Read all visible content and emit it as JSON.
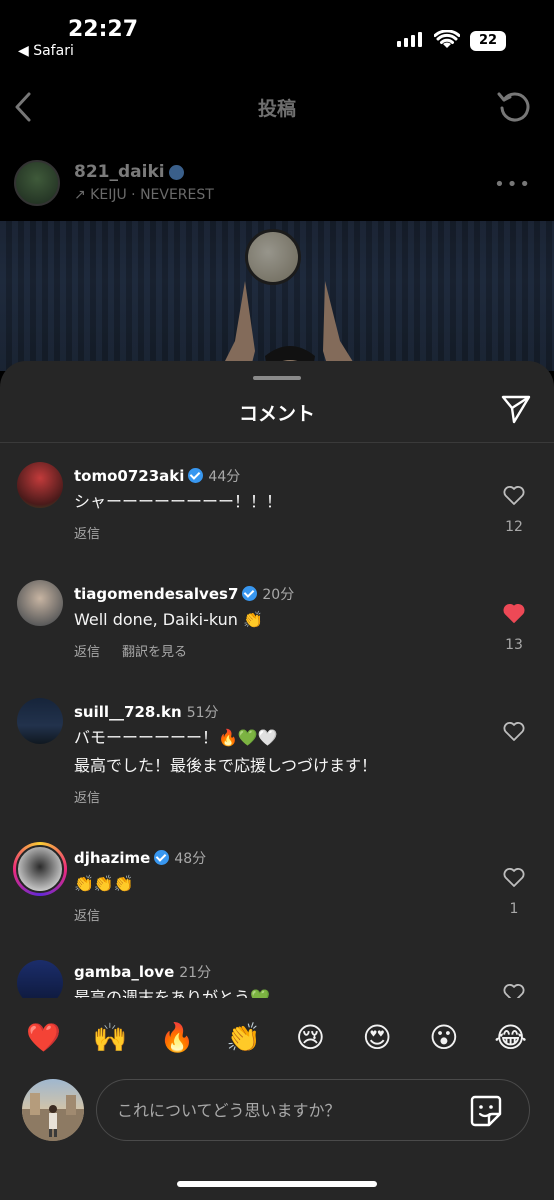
{
  "status_bar": {
    "time": "22:27",
    "back_app": "◀ Safari",
    "battery": "22"
  },
  "header": {
    "title": "投稿"
  },
  "post": {
    "username": "821_daiki",
    "sub": "↗ KEIJU · NEVEREST"
  },
  "sheet": {
    "title": "コメント"
  },
  "comments": [
    {
      "username": "tomo0723aki",
      "verified": true,
      "time": "44分",
      "lines": [
        "シャーーーーーーーー！！！"
      ],
      "actions": [
        "返信"
      ],
      "liked": false,
      "likes": "12"
    },
    {
      "username": "tiagomendesalves7",
      "verified": true,
      "time": "20分",
      "lines": [
        "Well done, Daiki-kun 👏"
      ],
      "actions": [
        "返信",
        "翻訳を見る"
      ],
      "liked": true,
      "likes": "13"
    },
    {
      "username": "suill__728.kn",
      "verified": false,
      "time": "51分",
      "lines": [
        "バモーーーーーー！🔥💚🤍",
        "最高でした！最後まで応援しつづけます！"
      ],
      "actions": [
        "返信"
      ],
      "liked": false,
      "likes": ""
    },
    {
      "username": "djhazime",
      "verified": true,
      "time": "48分",
      "lines": [
        "👏👏👏"
      ],
      "actions": [
        "返信"
      ],
      "liked": false,
      "likes": "1"
    },
    {
      "username": "gamba_love",
      "verified": false,
      "time": "21分",
      "lines": [
        "最高の週末をありがとう💚"
      ],
      "actions": [],
      "liked": false,
      "likes": ""
    }
  ],
  "emoji_bar": [
    "❤️",
    "🙌",
    "🔥",
    "👏",
    "😢",
    "😍",
    "😮",
    "😂"
  ],
  "composer": {
    "placeholder": "これについてどう思いますか？"
  },
  "colors": {
    "sheet_bg": "#262626",
    "verified": "#3897f0",
    "like_red": "#ed4956",
    "muted_text": "#a8a8a8"
  }
}
